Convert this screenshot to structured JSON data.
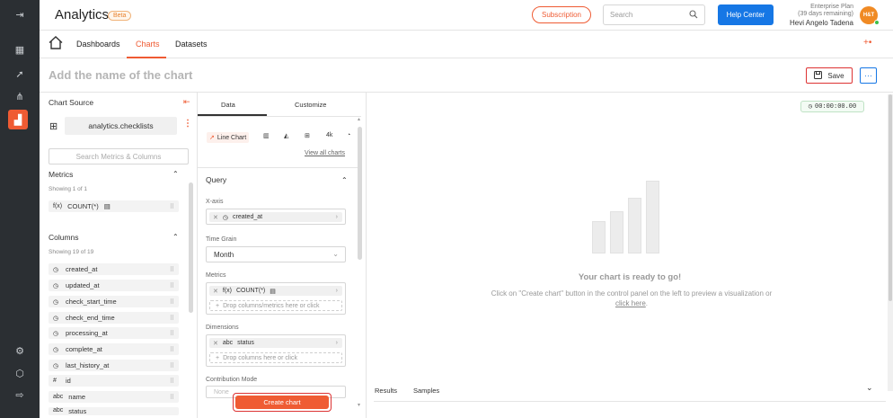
{
  "topbar": {
    "app_title": "Analytics",
    "beta_badge": "Beta",
    "subscription_label": "Subscription",
    "search_placeholder": "Search",
    "help_label": "Help Center",
    "plan_name": "Enterprise Plan",
    "plan_remaining": "(39 days remaining)",
    "user_name": "Hevi Angelo Tadena",
    "avatar_initials": "H&T"
  },
  "nav": {
    "tabs": [
      {
        "label": "Dashboards"
      },
      {
        "label": "Charts",
        "active": true
      },
      {
        "label": "Datasets"
      }
    ],
    "add_label": "+•"
  },
  "chart": {
    "name_placeholder": "Add the name of the chart",
    "save_label": "Save",
    "more_label": "···"
  },
  "source": {
    "title": "Chart Source",
    "dataset_name": "analytics.checklists",
    "search_placeholder": "Search Metrics & Columns",
    "metrics_title": "Metrics",
    "metrics_showing": "Showing 1 of 1",
    "metrics": [
      {
        "type": "f(x)",
        "name": "COUNT(*)"
      }
    ],
    "columns_title": "Columns",
    "columns_showing": "Showing 19 of 19",
    "columns": [
      {
        "type": "◷",
        "name": "created_at"
      },
      {
        "type": "◷",
        "name": "updated_at"
      },
      {
        "type": "◷",
        "name": "check_start_time"
      },
      {
        "type": "◷",
        "name": "check_end_time"
      },
      {
        "type": "◷",
        "name": "processing_at"
      },
      {
        "type": "◷",
        "name": "complete_at"
      },
      {
        "type": "◷",
        "name": "last_history_at"
      },
      {
        "type": "#",
        "name": "id"
      },
      {
        "type": "abc",
        "name": "name"
      },
      {
        "type": "abc",
        "name": "status"
      }
    ]
  },
  "control": {
    "tab_data": "Data",
    "tab_customize": "Customize",
    "chart_types": [
      {
        "label": "Line Chart",
        "active": true
      },
      {
        "label": ""
      },
      {
        "label": ""
      },
      {
        "label": ""
      },
      {
        "label": "4k"
      },
      {
        "label": ""
      }
    ],
    "view_all": "View all charts",
    "query_title": "Query",
    "xaxis_label": "X-axis",
    "xaxis_value": "created_at",
    "time_grain_label": "Time Grain",
    "time_grain_value": "Month",
    "metrics_label": "Metrics",
    "metric_value": "COUNT(*)",
    "metrics_drop": "Drop columns/metrics here or click",
    "dimensions_label": "Dimensions",
    "dimension_value": "status",
    "dimensions_drop": "Drop columns here or click",
    "contribution_label": "Contribution Mode",
    "contribution_placeholder": "None",
    "create_label": "Create chart"
  },
  "preview": {
    "timer": "00:00:00.00",
    "ready_title": "Your chart is ready to go!",
    "ready_desc": "Click on \"Create chart\" button in the control panel on the left to preview a visualization or",
    "ready_link": "click here",
    "ready_period": ".",
    "results_tab": "Results",
    "samples_tab": "Samples",
    "placeholder_bars": [
      0.35,
      0.46,
      0.61,
      0.79
    ]
  },
  "colors": {
    "accent": "#ef5b33",
    "primary": "#1677e5",
    "rail": "#2b2f33"
  }
}
